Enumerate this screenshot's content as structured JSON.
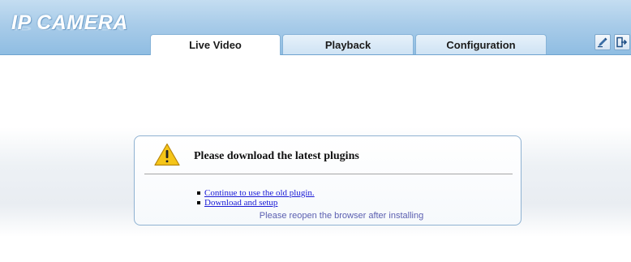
{
  "app": {
    "logo_text": "IP CAMERA"
  },
  "tabs": [
    {
      "label": "Live Video",
      "active": true
    },
    {
      "label": "Playback",
      "active": false
    },
    {
      "label": "Configuration",
      "active": false
    }
  ],
  "header_buttons": [
    {
      "icon": "edit-icon"
    },
    {
      "icon": "logout-icon"
    }
  ],
  "dialog": {
    "title": "Please download the latest plugins",
    "icon": "warning-icon",
    "options": [
      {
        "label": "Continue to use the old plugin."
      },
      {
        "label": "Download and setup"
      }
    ],
    "note": "Please reopen the browser after installing"
  },
  "colors": {
    "header": "#a9cce9",
    "link": "#1a1ad6",
    "note": "#5b5fb0",
    "warning": "#f5c518"
  }
}
